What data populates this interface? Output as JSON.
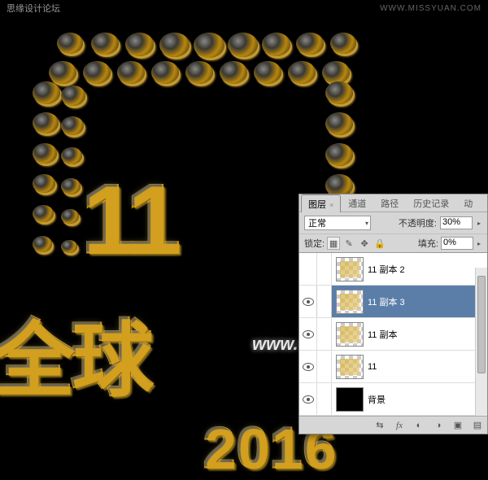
{
  "header": {
    "site": "思缘设计论坛",
    "url": "WWW.MISSYUAN.COM"
  },
  "artwork": {
    "big_number": "11",
    "main_text": "全球",
    "year": "2016",
    "watermark": "www.68ps.com"
  },
  "panel": {
    "tabs": [
      "图层",
      "通道",
      "路径",
      "历史记录",
      "动"
    ],
    "active_tab": 0,
    "blend_mode": "正常",
    "opacity_label": "不透明度:",
    "opacity_value": "30%",
    "lock_label": "锁定:",
    "fill_label": "填充:",
    "fill_value": "0%",
    "layers": [
      {
        "visible": false,
        "name": "11 副本 2",
        "checker": true,
        "thumb": true
      },
      {
        "visible": true,
        "name": "11 副本 3",
        "checker": true,
        "thumb": true,
        "selected": true
      },
      {
        "visible": true,
        "name": "11 副本",
        "checker": true,
        "thumb": true
      },
      {
        "visible": true,
        "name": "11",
        "checker": true,
        "thumb": true
      },
      {
        "visible": true,
        "name": "背景",
        "checker": false,
        "thumb": false
      }
    ]
  }
}
